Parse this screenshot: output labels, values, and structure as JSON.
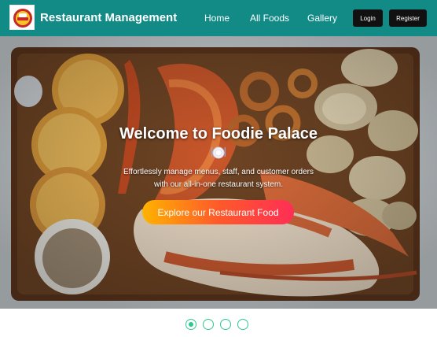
{
  "navbar": {
    "brand": "Restaurant Management",
    "links": [
      "Home",
      "All Foods",
      "Gallery"
    ],
    "login_label": "Login",
    "register_label": "Register",
    "color": "#128a86"
  },
  "hero": {
    "title": "Welcome to Foodie Palace",
    "description": "Effortlessly manage menus, staff, and customer orders with our all-in-one restaurant system.",
    "cta_label": "Explore our Restaurant Food",
    "icon": "plate-icon"
  },
  "carousel": {
    "slide_count": 4,
    "active_index": 0,
    "accent": "#2cc98e"
  }
}
